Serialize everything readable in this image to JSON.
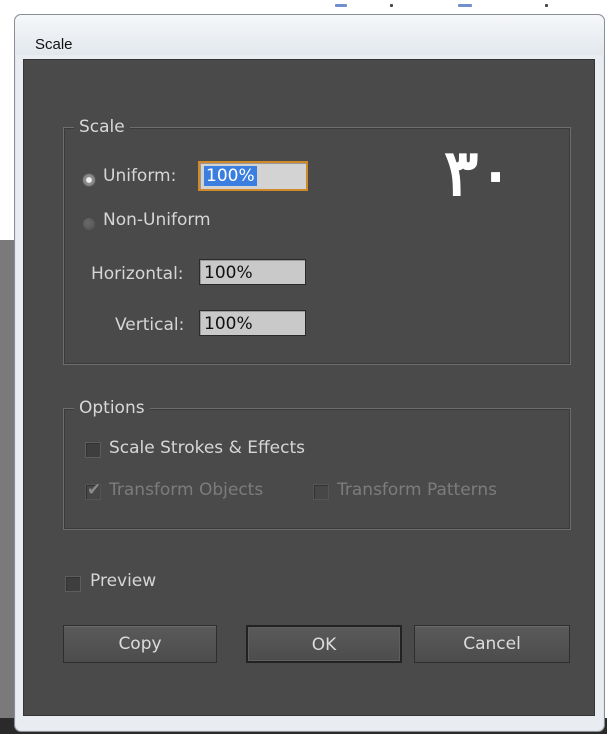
{
  "window": {
    "title": "Scale"
  },
  "overlay_text": "۳۰",
  "scale_group": {
    "legend": "Scale",
    "uniform": {
      "label": "Uniform:",
      "value": "100%",
      "selected": true
    },
    "non_uniform": {
      "label": "Non-Uniform",
      "selected": false
    },
    "horizontal": {
      "label": "Horizontal:",
      "value": "100%"
    },
    "vertical": {
      "label": "Vertical:",
      "value": "100%"
    }
  },
  "options_group": {
    "legend": "Options",
    "scale_strokes": {
      "label": "Scale Strokes & Effects",
      "checked": false
    },
    "transform_objects": {
      "label": "Transform Objects",
      "checked": true,
      "enabled": false
    },
    "transform_patterns": {
      "label": "Transform Patterns",
      "checked": false,
      "enabled": false
    }
  },
  "preview": {
    "label": "Preview",
    "checked": false
  },
  "buttons": {
    "copy": "Copy",
    "ok": "OK",
    "cancel": "Cancel"
  },
  "colors": {
    "dialog_bg": "#4a4a4a",
    "focus_ring": "#d08a2a",
    "selection": "#3a7fe0"
  }
}
